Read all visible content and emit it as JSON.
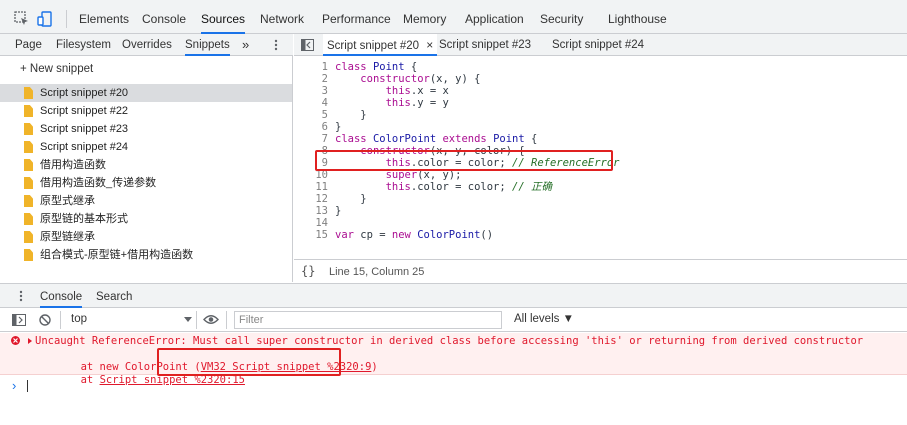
{
  "top_tabs": [
    "Elements",
    "Console",
    "Sources",
    "Network",
    "Performance",
    "Memory",
    "Application",
    "Security",
    "Lighthouse"
  ],
  "nav_tabs": [
    "Page",
    "Filesystem",
    "Overrides",
    "Snippets"
  ],
  "nav_more": "»",
  "new_snippet": "+ New snippet",
  "snippets": [
    "Script snippet #20",
    "Script snippet #22",
    "Script snippet #23",
    "Script snippet #24",
    "借用构造函数",
    "借用构造函数_传递参数",
    "原型式继承",
    "原型链的基本形式",
    "原型链继承",
    "组合模式-原型链+借用构造函数"
  ],
  "editor_tabs": [
    "Script snippet #20",
    "Script snippet #23",
    "Script snippet #24"
  ],
  "editor_tab_close": "×",
  "code_lines": [
    {
      "n": "1",
      "t": "class Point {"
    },
    {
      "n": "2",
      "t": "    constructor(x, y) {"
    },
    {
      "n": "3",
      "t": "        this.x = x"
    },
    {
      "n": "4",
      "t": "        this.y = y"
    },
    {
      "n": "5",
      "t": "    }"
    },
    {
      "n": "6",
      "t": "}"
    },
    {
      "n": "7",
      "t": "class ColorPoint extends Point {"
    },
    {
      "n": "8",
      "t": "    constructor(x, y, color) {"
    },
    {
      "n": "9",
      "t": "        this.color = color; // ReferenceError"
    },
    {
      "n": "10",
      "t": "        super(x, y);"
    },
    {
      "n": "11",
      "t": "        this.color = color; // 正确"
    },
    {
      "n": "12",
      "t": "    }"
    },
    {
      "n": "13",
      "t": "}"
    },
    {
      "n": "14",
      "t": ""
    },
    {
      "n": "15",
      "t": "var cp = new ColorPoint()"
    }
  ],
  "status": {
    "brace": "{}",
    "position": "Line 15, Column 25"
  },
  "drawer_tabs": [
    "Console",
    "Search"
  ],
  "console_toolbar": {
    "context": "top",
    "filter_placeholder": "Filter",
    "levels": "All levels ▼"
  },
  "error": {
    "line1": "Uncaught ReferenceError: Must call super constructor in derived class before accessing 'this' or returning from derived constructor",
    "line2_prefix": "    at new ColorPoint (",
    "line2_link": "VM32 Script snippet %2320:9",
    "line2_suffix": ")",
    "line3_prefix": "    at ",
    "line3_link": "Script snippet %2320:15"
  },
  "prompt_symbol": "›",
  "colors": {
    "accent": "#1a73e8",
    "error": "#e0182c",
    "highlight_box": "#e02020",
    "snippet_icon": "#f0b429"
  }
}
